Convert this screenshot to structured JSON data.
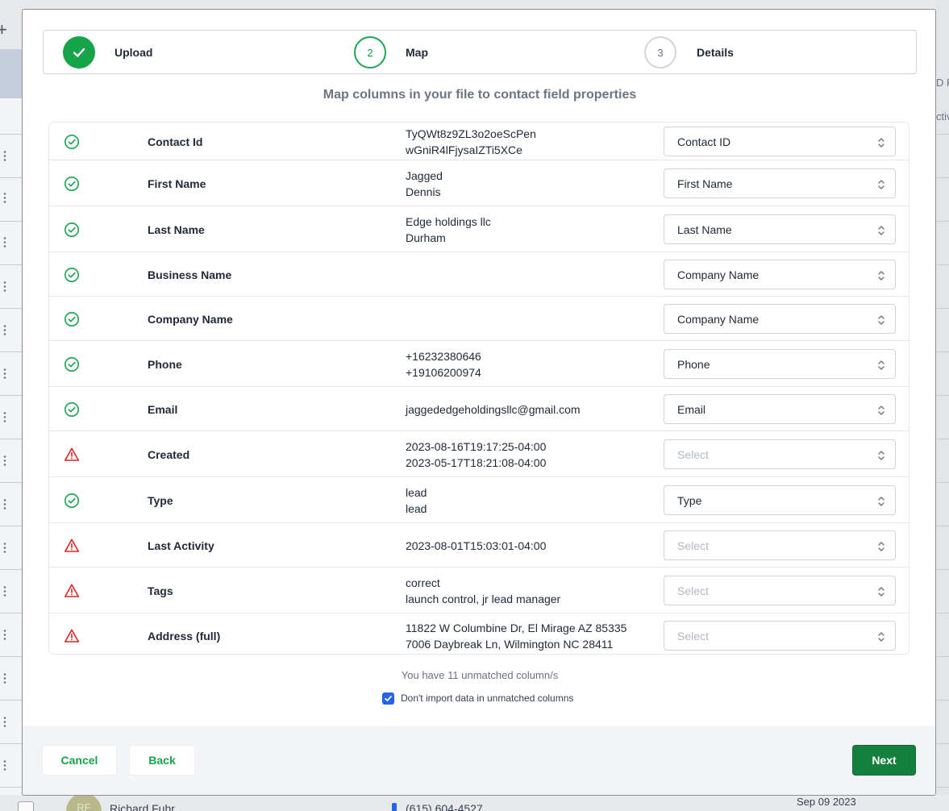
{
  "background": {
    "right_text_1": "D P",
    "right_text_2": "ctiv",
    "bottom_row": {
      "avatar_initials": "RF",
      "name": "Richard Fuhr",
      "phone": "(615) 604-4527",
      "date": "Sep 09 2023"
    }
  },
  "stepper": {
    "steps": [
      {
        "number": "1",
        "label": "Upload",
        "state": "done"
      },
      {
        "number": "2",
        "label": "Map",
        "state": "active"
      },
      {
        "number": "3",
        "label": "Details",
        "state": "todo"
      }
    ]
  },
  "subtitle": "Map columns in your file to contact field properties",
  "mapping": {
    "placeholder": "Select",
    "rows": [
      {
        "status": "matched",
        "label": "Contact Id",
        "samples": [
          "TyQWt8z9ZL3o2oeScPen",
          "wGniR4lFjysaIZTi5XCe"
        ],
        "field": "Contact ID"
      },
      {
        "status": "matched",
        "label": "First Name",
        "samples": [
          "Jagged",
          "Dennis"
        ],
        "field": "First Name"
      },
      {
        "status": "matched",
        "label": "Last Name",
        "samples": [
          "Edge holdings llc",
          "Durham"
        ],
        "field": "Last Name"
      },
      {
        "status": "matched",
        "label": "Business Name",
        "samples": [],
        "field": "Company Name"
      },
      {
        "status": "matched",
        "label": "Company Name",
        "samples": [],
        "field": "Company Name"
      },
      {
        "status": "matched",
        "label": "Phone",
        "samples": [
          "+16232380646",
          "+19106200974"
        ],
        "field": "Phone"
      },
      {
        "status": "matched",
        "label": "Email",
        "samples": [
          "jaggededgeholdingsllc@gmail.com"
        ],
        "field": "Email"
      },
      {
        "status": "unmatched",
        "label": "Created",
        "samples": [
          "2023-08-16T19:17:25-04:00",
          "2023-05-17T18:21:08-04:00"
        ],
        "field": ""
      },
      {
        "status": "matched",
        "label": "Type",
        "samples": [
          "lead",
          "lead"
        ],
        "field": "Type"
      },
      {
        "status": "unmatched",
        "label": "Last Activity",
        "samples": [
          "2023-08-01T15:03:01-04:00"
        ],
        "field": ""
      },
      {
        "status": "unmatched",
        "label": "Tags",
        "samples": [
          "correct",
          "launch control, jr lead manager"
        ],
        "field": ""
      },
      {
        "status": "unmatched",
        "label": "Address (full)",
        "samples": [
          "11822 W Columbine Dr, El Mirage AZ 85335",
          "7006 Daybreak Ln, Wilmington NC 28411"
        ],
        "field": ""
      }
    ]
  },
  "unmatched_text": "You have 11 unmatched column/s",
  "dont_import": {
    "label": "Don't import data in unmatched columns",
    "checked": true
  },
  "footer": {
    "cancel_label": "Cancel",
    "back_label": "Back",
    "next_label": "Next"
  },
  "colors": {
    "success": "#16a34a",
    "error": "#dc2626",
    "primary_button": "#15803d",
    "checkbox": "#2563eb"
  }
}
